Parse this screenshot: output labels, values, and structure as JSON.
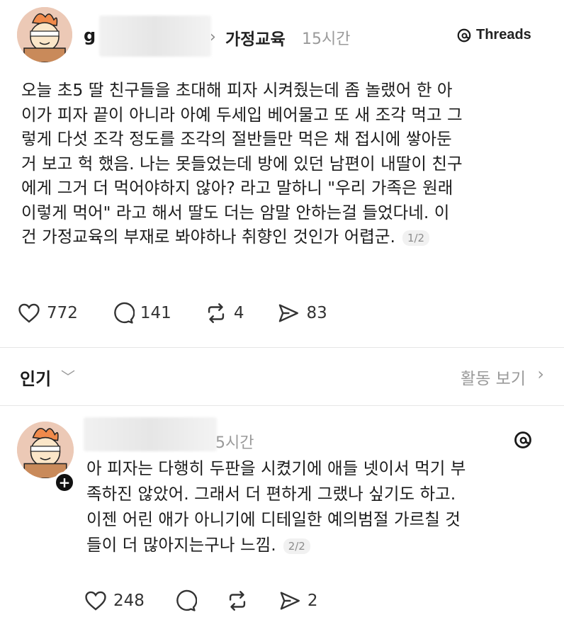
{
  "post": {
    "username": "g",
    "topic": "가정교육",
    "time": "15시간",
    "threads_label": "Threads",
    "body_lines": [
      "오늘 초5 딸 친구들을 초대해 피자 시켜줬는데 좀 놀랬어 한 아",
      "이가 피자 끝이 아니라 아예 두세입 베어물고 또 새 조각 먹고 그",
      "렇게 다섯 조각 정도를 조각의 절반들만 먹은 채 접시에 쌓아둔",
      "거 보고 헉 했음. 나는 못들었는데 방에 있던 남편이 내딸이 친구",
      "에게 그거 더 먹어야하지 않아? 라고 말하니 \"우리 가족은 원래",
      "이렇게 먹어\" 라고 해서 딸도 더는 암말 안하는걸 들었다네. 이",
      "건 가정교육의 부재로 봐야하나 취향인 것인가 어렵군."
    ],
    "pager": "1/2",
    "likes": "772",
    "comments": "141",
    "reposts": "4",
    "shares": "83"
  },
  "sort": {
    "label": "인기",
    "activity": "활동 보기"
  },
  "reply": {
    "time": "5시간",
    "body_lines": [
      "아 피자는 다행히 두판을 시켰기에 애들 넷이서 먹기 부",
      "족하진 않았어. 그래서 더 편하게 그랬나 싶기도 하고.",
      "이젠 어린 애가 아니기에 디테일한 예의범절 가르칠 것",
      "들이 더 많아지는구나 느낌."
    ],
    "pager": "2/2",
    "likes": "248",
    "shares": "2"
  },
  "icons": {
    "like": "heart-icon",
    "comment": "comment-bubble-icon",
    "repost": "repost-icon",
    "share": "send-icon",
    "threads": "threads-logo-icon",
    "follow": "plus-icon"
  }
}
